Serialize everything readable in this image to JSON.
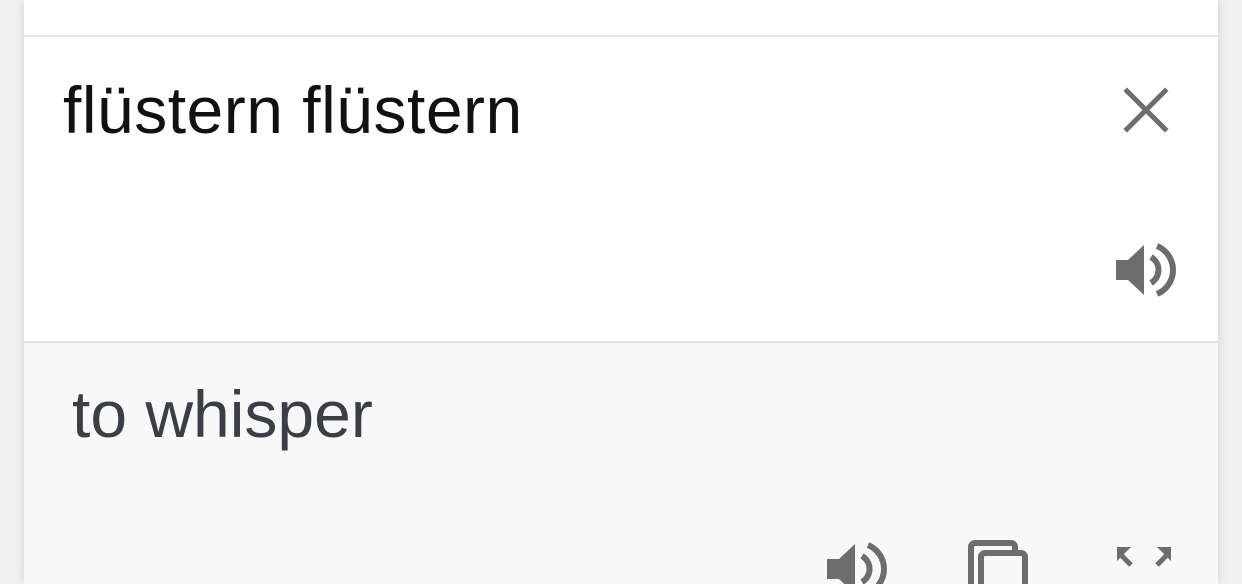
{
  "source": {
    "text": "flüstern flüstern",
    "clear_icon": "close-icon",
    "listen_icon": "speaker-icon"
  },
  "result": {
    "text": "to whisper",
    "actions": [
      {
        "name": "listen",
        "icon": "speaker-icon"
      },
      {
        "name": "copy",
        "icon": "copy-icon"
      },
      {
        "name": "fullscreen",
        "icon": "expand-icon"
      }
    ]
  },
  "colors": {
    "icon": "#6d6d6d",
    "source_text": "#111111",
    "result_text": "#3b3f44",
    "result_background": "#f8f8f8",
    "divider": "#e0e0e0"
  }
}
